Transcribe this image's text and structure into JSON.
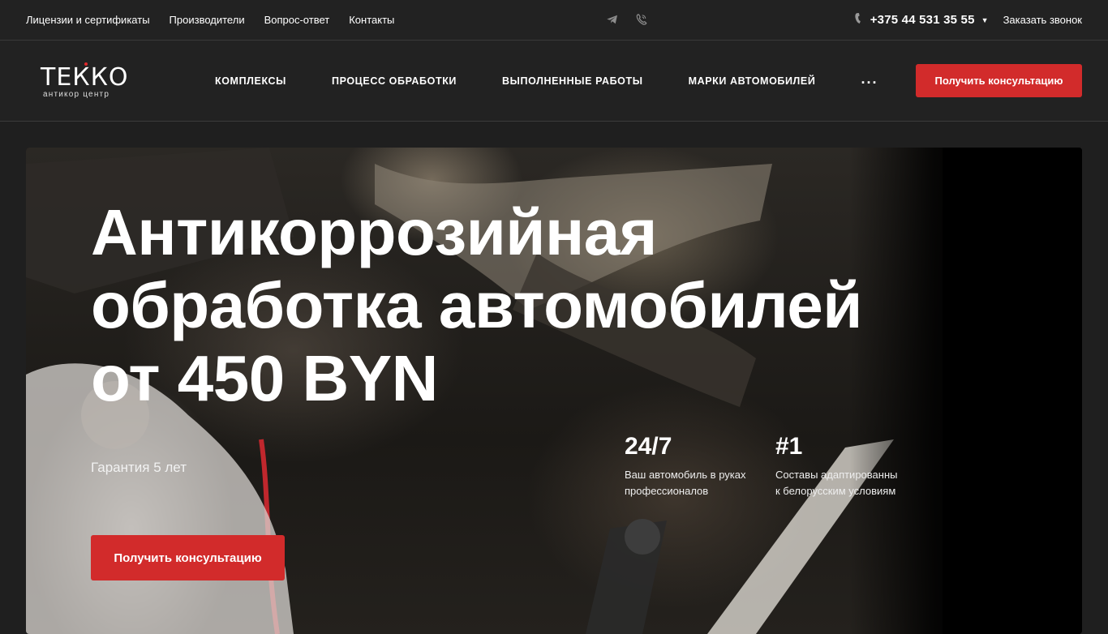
{
  "topbar": {
    "links": [
      "Лицензии и сертификаты",
      "Производители",
      "Вопрос-ответ",
      "Контакты"
    ],
    "phone": "+375 44 531 35 55",
    "callback_label": "Заказать звонок"
  },
  "header": {
    "logo_text": "ТЕККО",
    "logo_sub": "антикор центр",
    "nav": [
      "КОМПЛЕКСЫ",
      "ПРОЦЕСС ОБРАБОТКИ",
      "ВЫПОЛНЕННЫЕ РАБОТЫ",
      "МАРКИ АВТОМОБИЛЕЙ"
    ],
    "more_label": "...",
    "cta_label": "Получить консультацию"
  },
  "hero": {
    "title_lines": [
      "Антикоррозийная",
      "обработка автомобилей",
      "от 450 BYN"
    ],
    "guarantee": "Гарантия 5 лет",
    "stats": [
      {
        "value": "24/7",
        "lines": [
          "Ваш автомобиль в руках",
          "профессионалов"
        ]
      },
      {
        "value": "#1",
        "lines": [
          "Составы адаптированны",
          "к белорусским условиям"
        ]
      }
    ],
    "cta_label": "Получить консультацию"
  },
  "colors": {
    "accent": "#d22b2b",
    "background": "#222222"
  },
  "icons": [
    "telegram-icon",
    "viber-icon",
    "phone-icon",
    "chevron-down-icon",
    "more-dots-icon"
  ]
}
